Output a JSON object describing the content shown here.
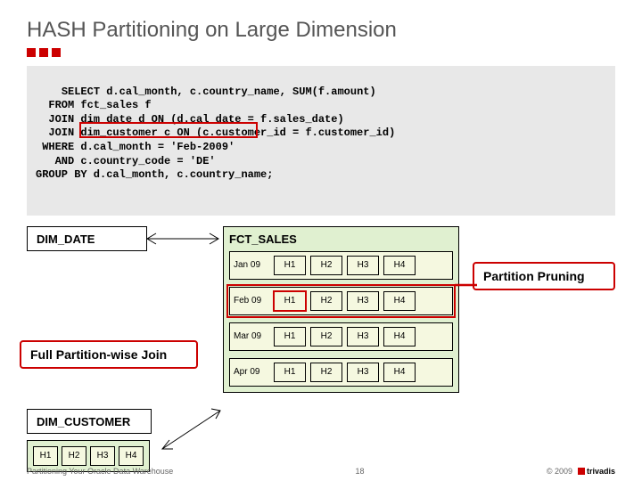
{
  "title": "HASH Partitioning on Large Dimension",
  "sql": "SELECT d.cal_month, c.country_name, SUM(f.amount)\n  FROM fct_sales f\n  JOIN dim_date d ON (d.cal_date = f.sales_date)\n  JOIN dim_customer c ON (c.customer_id = f.customer_id)\n WHERE d.cal_month = 'Feb-2009'\n   AND c.country_code = 'DE'\nGROUP BY d.cal_month, c.country_name;",
  "dim_date": "DIM_DATE",
  "dim_customer": "DIM_CUSTOMER",
  "fct": {
    "title": "FCT_SALES",
    "rows": [
      {
        "label": "Jan 09"
      },
      {
        "label": "Feb 09"
      },
      {
        "label": "Mar 09"
      },
      {
        "label": "Apr 09"
      }
    ],
    "cols": [
      "H1",
      "H2",
      "H3",
      "H4"
    ]
  },
  "hash_cols": [
    "H1",
    "H2",
    "H3",
    "H4"
  ],
  "callouts": {
    "pruning": "Partition Pruning",
    "join": "Full Partition-wise Join"
  },
  "footer": {
    "left": "Partitioning Your Oracle Data Warehouse",
    "page": "18",
    "right": "© 2009",
    "logo": "trivadis"
  }
}
